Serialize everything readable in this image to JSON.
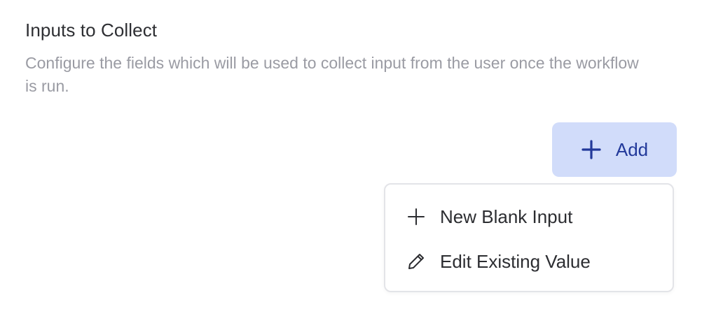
{
  "section": {
    "title": "Inputs to Collect",
    "description": "Configure the fields which will be used to collect input from the user once the workflow is run."
  },
  "add_button": {
    "label": "Add",
    "icon": "plus-icon",
    "background": "#d1dcfa",
    "text_color": "#22399a"
  },
  "menu": {
    "items": [
      {
        "label": "New Blank Input",
        "icon": "plus-icon"
      },
      {
        "label": "Edit Existing Value",
        "icon": "pencil-icon"
      }
    ]
  }
}
